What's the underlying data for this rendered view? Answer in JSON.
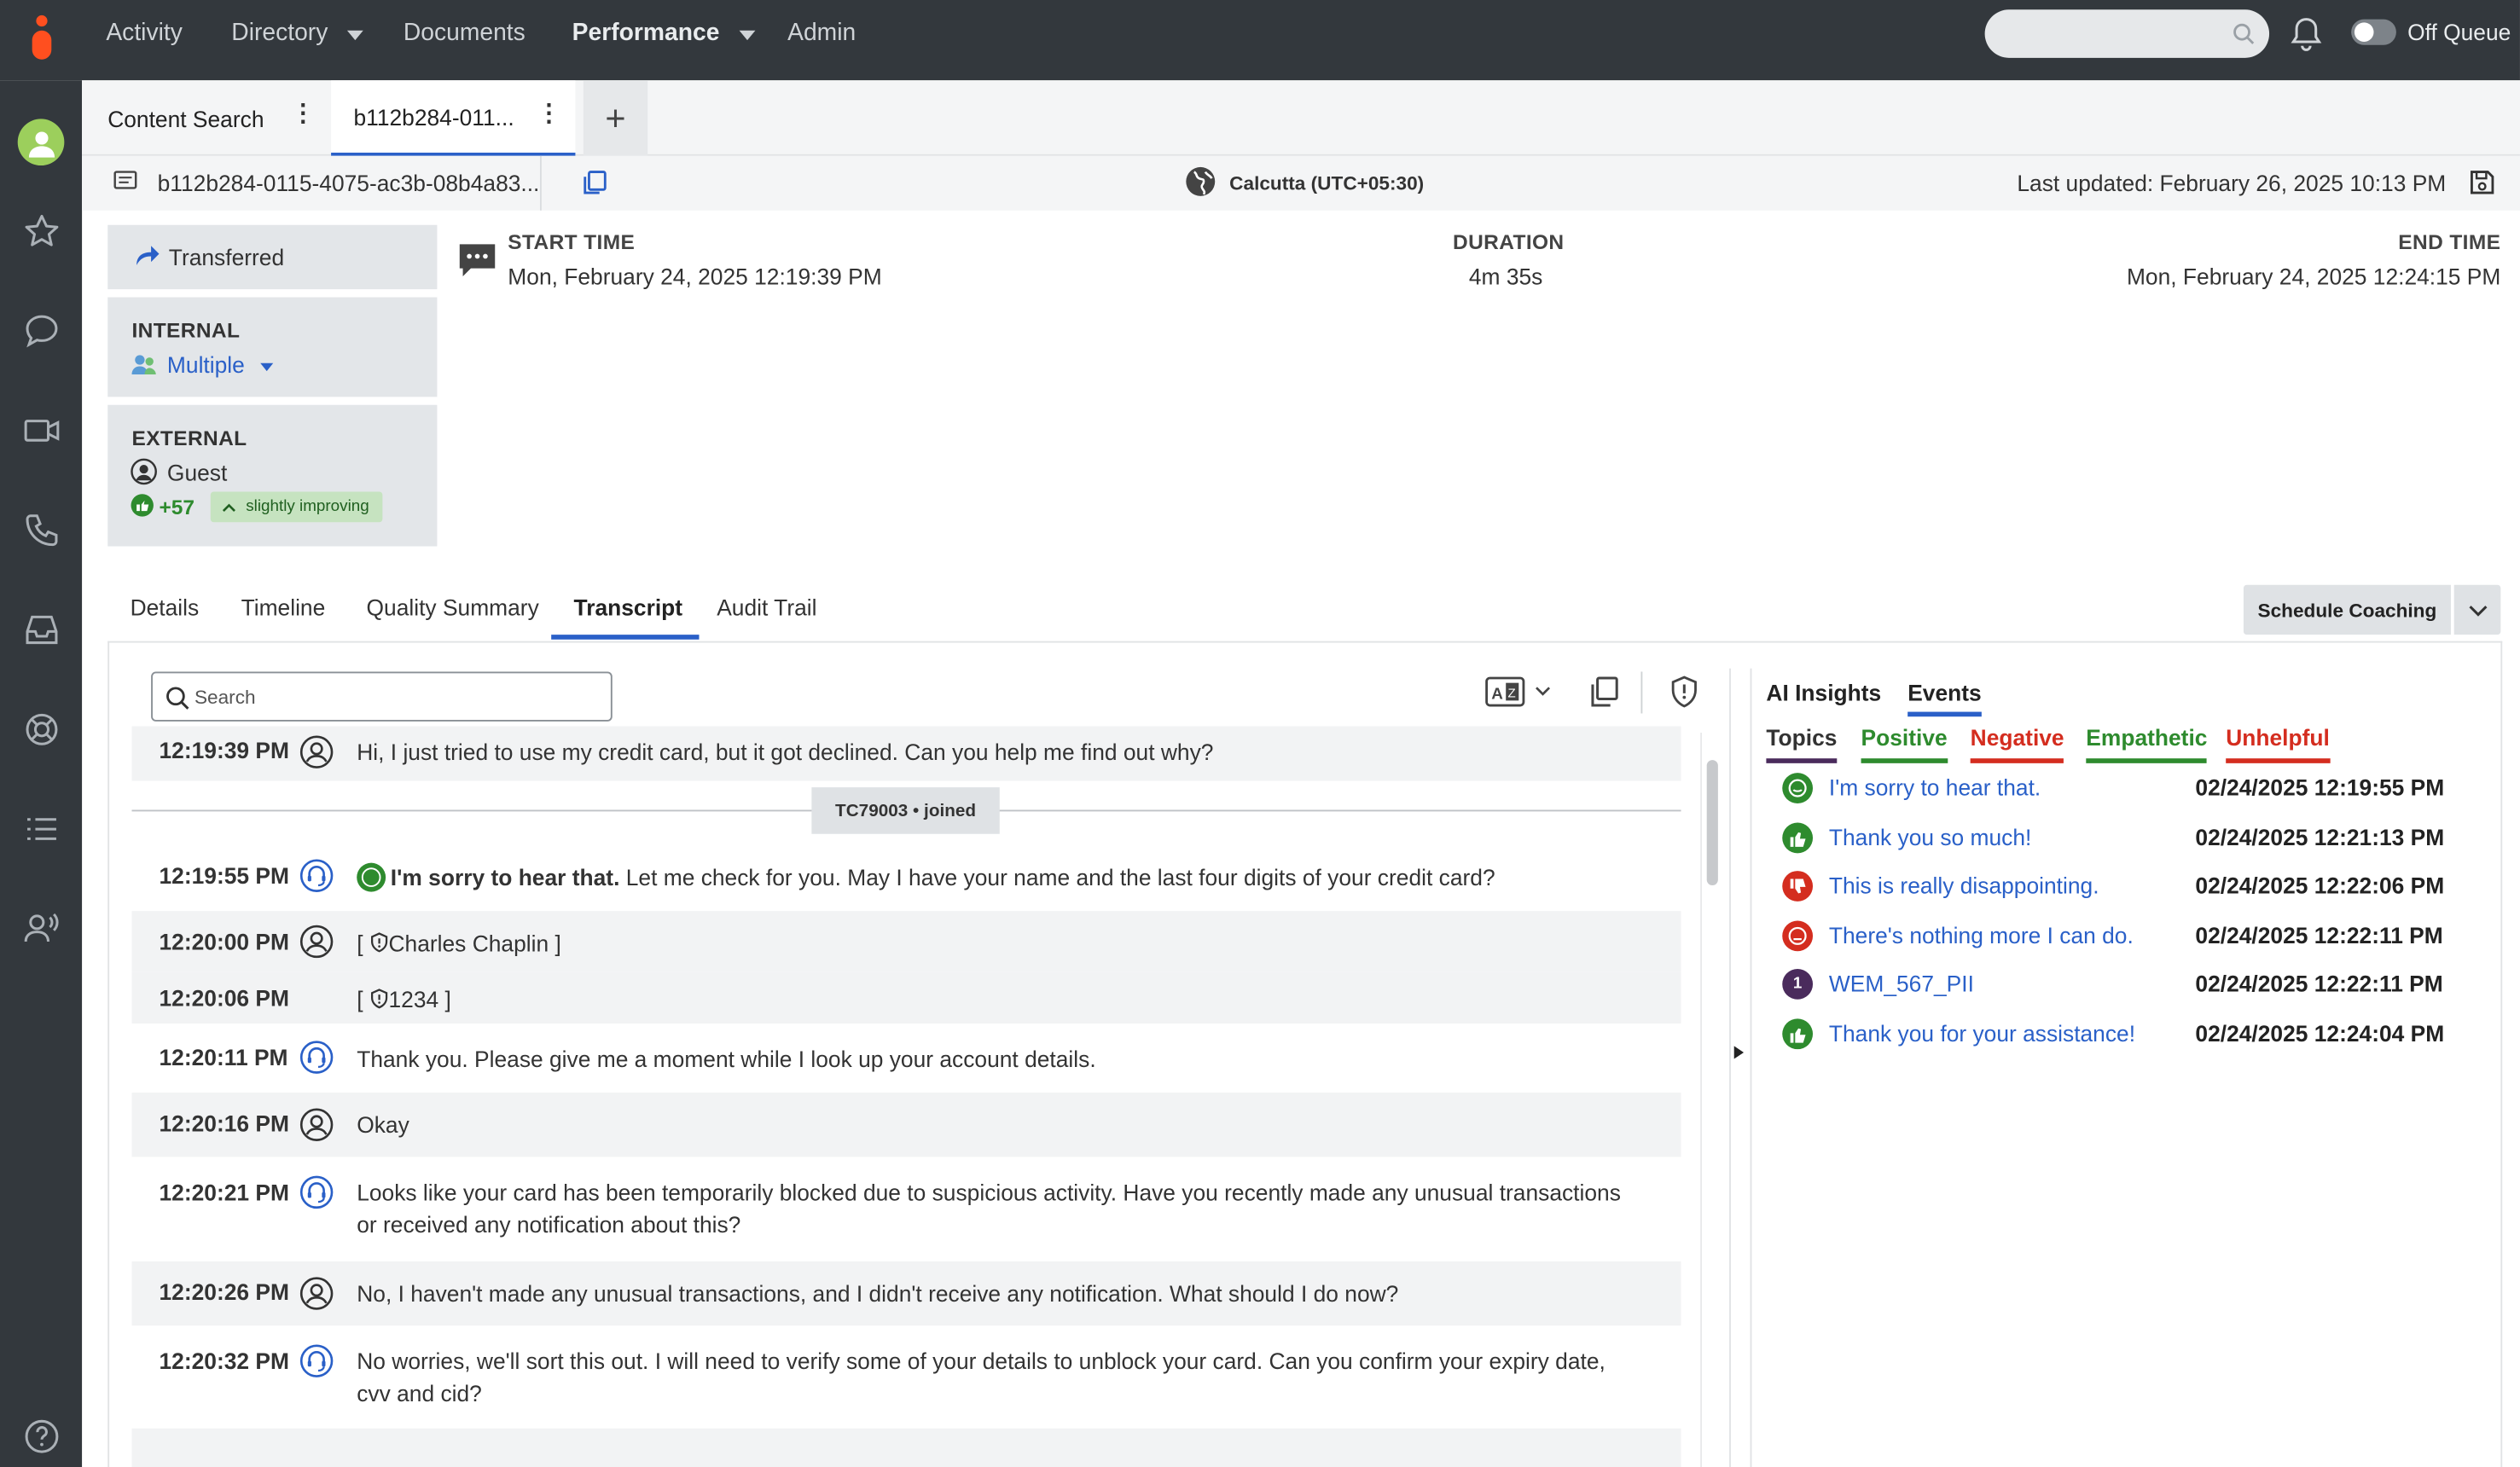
{
  "nav": {
    "items": [
      "Activity",
      "Directory",
      "Documents",
      "Performance",
      "Admin"
    ],
    "queue_status": "Off Queue"
  },
  "tabs": {
    "content_search": "Content Search",
    "interaction": "b112b284-011...",
    "add": "+"
  },
  "infobar": {
    "conversation_id": "b112b284-0115-4075-ac3b-08b4a83...",
    "timezone": "Calcutta (UTC+05:30)",
    "last_updated": "Last updated: February 26, 2025 10:13 PM"
  },
  "participants": {
    "status": "Transferred",
    "internal_label": "INTERNAL",
    "internal_value": "Multiple",
    "external_label": "EXTERNAL",
    "external_value": "Guest",
    "sentiment_score": "+57",
    "sentiment_trend": "slightly improving"
  },
  "times": {
    "start_label": "START TIME",
    "start_value": "Mon, February 24, 2025 12:19:39 PM",
    "duration_label": "DURATION",
    "duration_value": "4m 35s",
    "end_label": "END TIME",
    "end_value": "Mon, February 24, 2025 12:24:15 PM"
  },
  "detail_tabs": [
    "Details",
    "Timeline",
    "Quality Summary",
    "Transcript",
    "Audit Trail"
  ],
  "schedule_coaching": "Schedule Coaching",
  "transcript": {
    "search_placeholder": "Search",
    "joined_marker": "TC79003 • joined",
    "rows": [
      {
        "time": "12:19:39 PM",
        "speaker": "customer",
        "text": "Hi, I just tried to use my credit card, but it got declined. Can you help me find out why?"
      },
      {
        "time": "12:19:55 PM",
        "speaker": "agent",
        "highlight": "I'm sorry to hear that.",
        "text": " Let me check for you. May I have your name and the last four digits of your credit card?"
      },
      {
        "time": "12:20:00 PM",
        "speaker": "customer",
        "redacted": "Charles Chaplin"
      },
      {
        "time": "12:20:06 PM",
        "speaker": "none",
        "redacted": "1234"
      },
      {
        "time": "12:20:11 PM",
        "speaker": "agent",
        "text": "Thank you. Please give me a moment while I look up your account details."
      },
      {
        "time": "12:20:16 PM",
        "speaker": "customer",
        "text": "Okay"
      },
      {
        "time": "12:20:21 PM",
        "speaker": "agent",
        "text": "Looks like your card has been temporarily blocked due to suspicious activity. Have you recently made any unusual transactions or received any notification about this?"
      },
      {
        "time": "12:20:26 PM",
        "speaker": "customer",
        "text": "No, I haven't made any unusual transactions, and I didn't receive any notification. What should I do now?"
      },
      {
        "time": "12:20:32 PM",
        "speaker": "agent",
        "text": "No worries, we'll sort this out. I will need to verify some of your details to unblock your card. Can you confirm your expiry date, cvv and cid?"
      }
    ]
  },
  "insights": {
    "tabs": [
      "AI Insights",
      "Events"
    ],
    "filters": [
      {
        "label": "Topics",
        "color": "#4a2b5c"
      },
      {
        "label": "Positive",
        "color": "#2e8b2e"
      },
      {
        "label": "Negative",
        "color": "#d42d1f"
      },
      {
        "label": "Empathetic",
        "color": "#2e8b2e"
      },
      {
        "label": "Unhelpful",
        "color": "#d42d1f"
      }
    ],
    "events": [
      {
        "text": "I'm sorry to hear that.",
        "time": "02/24/2025 12:19:55 PM",
        "kind": "empathetic"
      },
      {
        "text": "Thank you so much!",
        "time": "02/24/2025 12:21:13 PM",
        "kind": "positive"
      },
      {
        "text": "This is really disappointing.",
        "time": "02/24/2025 12:22:06 PM",
        "kind": "negative"
      },
      {
        "text": "There's nothing more I can do.",
        "time": "02/24/2025 12:22:11 PM",
        "kind": "unhelpful"
      },
      {
        "text": "WEM_567_PII",
        "time": "02/24/2025 12:22:11 PM",
        "kind": "topic",
        "badge": "1"
      },
      {
        "text": "Thank you for your assistance!",
        "time": "02/24/2025 12:24:04 PM",
        "kind": "positive"
      }
    ]
  }
}
